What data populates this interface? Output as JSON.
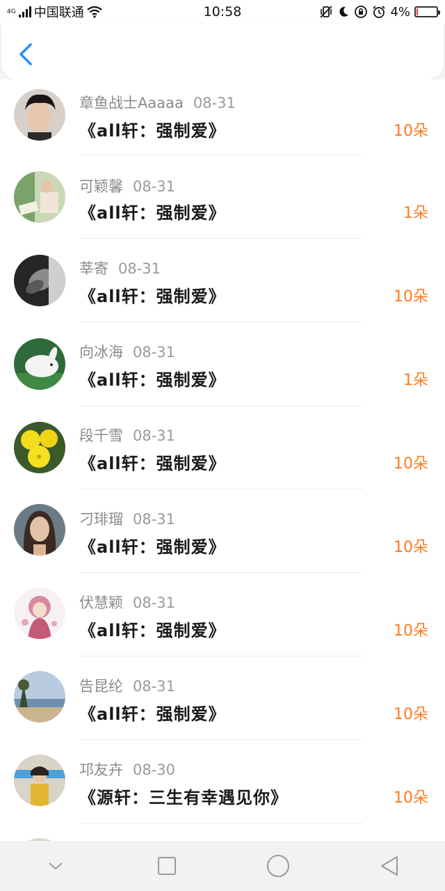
{
  "status_bar": {
    "network": "4G",
    "carrier": "中国联通",
    "time": "10:58",
    "battery_percent": "4%",
    "battery_level": 0.04,
    "colors": {
      "battery_low": "#e33"
    }
  },
  "header": {
    "back_icon": "chevron-left-icon",
    "accent": "#1e90ff"
  },
  "items": [
    {
      "name": "章鱼战士Aaaaa",
      "date": "08-31",
      "title": "《all轩：强制爱》",
      "amount": "10朵"
    },
    {
      "name": "可颖馨",
      "date": "08-31",
      "title": "《all轩：强制爱》",
      "amount": "1朵"
    },
    {
      "name": "莘寄",
      "date": "08-31",
      "title": "《all轩：强制爱》",
      "amount": "10朵"
    },
    {
      "name": "向冰海",
      "date": "08-31",
      "title": "《all轩：强制爱》",
      "amount": "1朵"
    },
    {
      "name": "段千雪",
      "date": "08-31",
      "title": "《all轩：强制爱》",
      "amount": "10朵"
    },
    {
      "name": "刁琲瑠",
      "date": "08-31",
      "title": "《all轩：强制爱》",
      "amount": "10朵"
    },
    {
      "name": "伏慧颖",
      "date": "08-31",
      "title": "《all轩：强制爱》",
      "amount": "10朵"
    },
    {
      "name": "告昆纶",
      "date": "08-31",
      "title": "《all轩：强制爱》",
      "amount": "10朵"
    },
    {
      "name": "邛友卉",
      "date": "08-30",
      "title": "《源轩：三生有幸遇见你》",
      "amount": "10朵"
    }
  ],
  "colors": {
    "amount": "#ff7a1f",
    "name": "#8a8a8a"
  },
  "nav_bar": {
    "icons": [
      "chevron-down-icon",
      "square-icon",
      "circle-icon",
      "triangle-back-icon"
    ]
  }
}
